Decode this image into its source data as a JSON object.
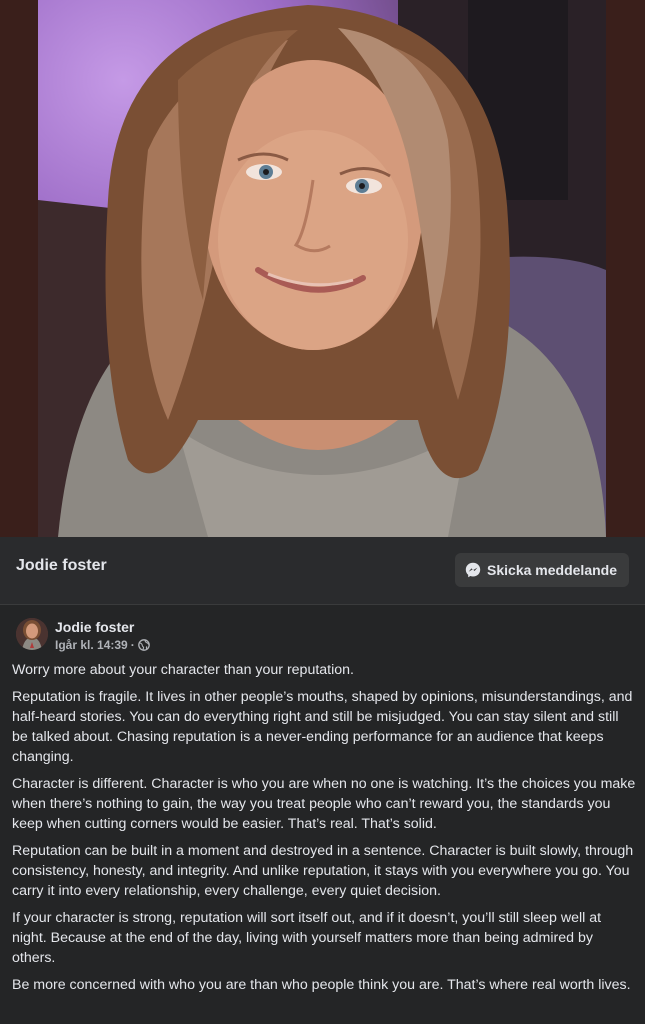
{
  "photo": {
    "alt": ""
  },
  "profile": {
    "name": "Jodie foster",
    "message_button_label": "Skicka meddelande",
    "message_icon": "messenger-icon"
  },
  "post": {
    "author": "Jodie foster",
    "timestamp": "Igår kl. 14:39",
    "audience_icon": "globe-icon",
    "paragraphs": [
      "Worry more about your character than your reputation.",
      "Reputation is fragile. It lives in other people’s mouths, shaped by opinions, misunderstandings, and half-heard stories. You can do everything right and still be misjudged. You can stay silent and still be talked about. Chasing reputation is a never-ending performance for an audience that keeps changing.",
      "Character is different. Character is who you are when no one is watching. It’s the choices you make when there’s nothing to gain, the way you treat people who can’t reward you, the standards you keep when cutting corners would be easier. That’s real. That’s solid.",
      "Reputation can be built in a moment and destroyed in a sentence. Character is built slowly, through consistency, honesty, and integrity. And unlike reputation, it stays with you everywhere you go. You carry it into every relationship, every challenge, every quiet decision.",
      "If your character is strong, reputation will sort itself out, and if it doesn’t, you’ll still sleep well at night. Because at the end of the day, living with yourself matters more than being admired by others.",
      "Be more concerned with who you are than who people think you are. That’s where real worth lives."
    ]
  },
  "colors": {
    "background": "#242526",
    "button": "#3a3b3c",
    "text": "#e4e6eb",
    "secondary_text": "#b0b3b8"
  }
}
